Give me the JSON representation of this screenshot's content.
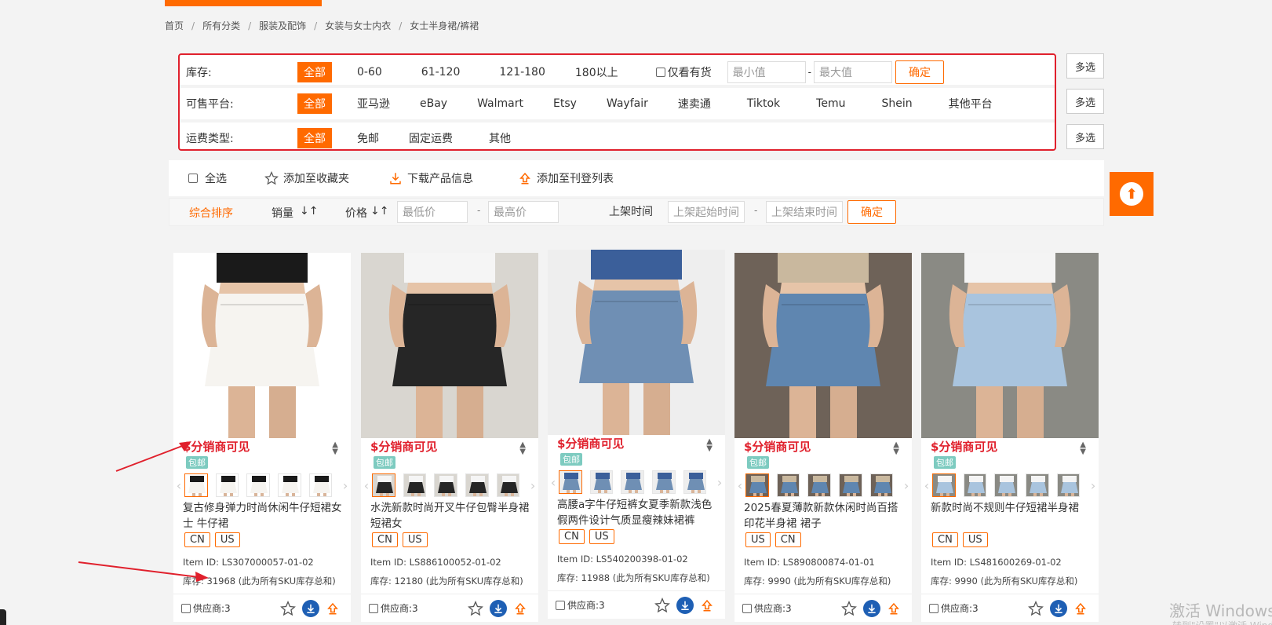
{
  "breadcrumb": [
    "首页",
    "所有分类",
    "服装及配饰",
    "女装与女士内衣",
    "女士半身裙/裤裙"
  ],
  "filters": {
    "stock": {
      "label": "库存:",
      "options": [
        "全部",
        "0-60",
        "61-120",
        "121-180",
        "180以上"
      ],
      "in_stock_only": "仅看有货",
      "min_placeholder": "最小值",
      "max_placeholder": "最大值",
      "range_sep": "-",
      "confirm": "确定"
    },
    "platform": {
      "label": "可售平台:",
      "options": [
        "全部",
        "亚马逊",
        "eBay",
        "Walmart",
        "Etsy",
        "Wayfair",
        "速卖通",
        "Tiktok",
        "Temu",
        "Shein",
        "其他平台"
      ]
    },
    "shipping": {
      "label": "运费类型:",
      "options": [
        "全部",
        "免邮",
        "固定运费",
        "其他"
      ]
    },
    "multi_select": "多选"
  },
  "actions": {
    "select_all": "全选",
    "add_favorite": "添加至收藏夹",
    "download_info": "下载产品信息",
    "add_listing": "添加至刊登列表"
  },
  "sort": {
    "comprehensive": "综合排序",
    "sales": "销量",
    "price": "价格",
    "min_price_placeholder": "最低价",
    "max_price_placeholder": "最高价",
    "range_sep": "-",
    "listed_time": "上架时间",
    "start_time_placeholder": "上架起始时间",
    "end_time_placeholder": "上架结束时间",
    "confirm": "确定"
  },
  "products": [
    {
      "price": "$分销商可见",
      "free_ship": "包邮",
      "title": "复古修身弹力时尚休闲牛仔短裙女士 牛仔裙",
      "tags": [
        "CN",
        "US"
      ],
      "item_id": "Item ID:  LS307000057-01-02",
      "stock": "库存:  31968 (此为所有SKU库存总和)",
      "supplier": "供应商:3",
      "skirt_color": "#f6f4f0",
      "top_color": "#1a1a1a",
      "bg_color": "#ffffff"
    },
    {
      "price": "$分销商可见",
      "free_ship": "包邮",
      "title": "水洗新款时尚开叉牛仔包臀半身裙短裙女",
      "tags": [
        "CN",
        "US"
      ],
      "item_id": "Item ID:  LS886100052-01-02",
      "stock": "库存:  12180 (此为所有SKU库存总和)",
      "supplier": "供应商:3",
      "skirt_color": "#262626",
      "top_color": "#f5f5f5",
      "bg_color": "#d9d6d0"
    },
    {
      "price": "$分销商可见",
      "free_ship": "包邮",
      "title": "高腰a字牛仔短裤女夏季新款浅色假两件设计气质显瘦辣妹裙裤",
      "tags": [
        "CN",
        "US"
      ],
      "item_id": "Item ID:  LS540200398-01-02",
      "stock": "库存:  11988 (此为所有SKU库存总和)",
      "supplier": "供应商:3",
      "skirt_color": "#6f8fb4",
      "top_color": "#3b5f9a",
      "bg_color": "#eeeeee"
    },
    {
      "price": "$分销商可见",
      "free_ship": "包邮",
      "title": "2025春夏薄款新款休闲时尚百搭印花半身裙 裙子",
      "tags": [
        "US",
        "CN"
      ],
      "item_id": "Item ID:  LS890800874-01-01",
      "stock": "库存:  9990 (此为所有SKU库存总和)",
      "supplier": "供应商:3",
      "skirt_color": "#5f86b0",
      "top_color": "#c9b89e",
      "bg_color": "#6e6258"
    },
    {
      "price": "$分销商可见",
      "free_ship": "包邮",
      "title": "新款时尚不规则牛仔短裙半身裙",
      "tags": [
        "CN",
        "US"
      ],
      "item_id": "Item ID:  LS481600269-01-02",
      "stock": "库存:  9990 (此为所有SKU库存总和)",
      "supplier": "供应商:3",
      "skirt_color": "#a9c4de",
      "top_color": "#f4f4f4",
      "bg_color": "#8a8a84"
    }
  ],
  "watermark": {
    "line1": "激活 Windows",
    "line2": "转到\"设置\"以激活 Windows。"
  },
  "colors": {
    "accent": "#ff6a00",
    "price_red": "#e0202c",
    "free_ship_teal": "#7dcbc0",
    "download_blue": "#1e5fb4"
  }
}
